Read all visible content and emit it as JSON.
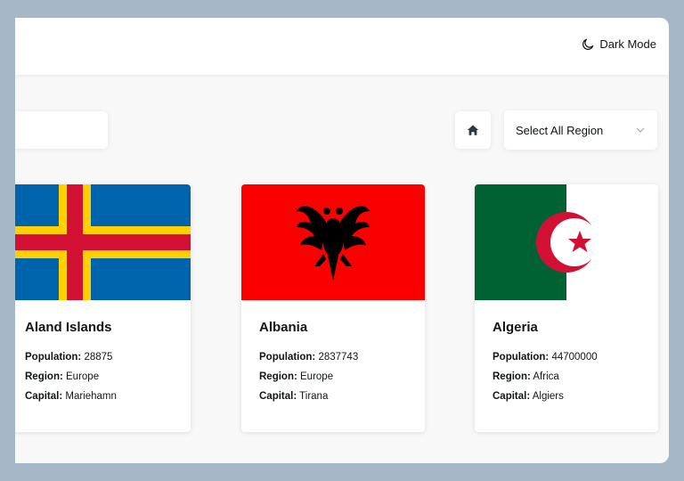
{
  "header": {
    "dark_mode_label": "Dark Mode"
  },
  "filters": {
    "region_select_label": "Select All Region"
  },
  "labels": {
    "population": "Population:",
    "region": "Region:",
    "capital": "Capital:"
  },
  "countries": [
    {
      "name": "Aland Islands",
      "population": "28875",
      "region": "Europe",
      "capital": "Mariehamn"
    },
    {
      "name": "Albania",
      "population": "2837743",
      "region": "Europe",
      "capital": "Tirana"
    },
    {
      "name": "Algeria",
      "population": "44700000",
      "region": "Africa",
      "capital": "Algiers"
    }
  ]
}
